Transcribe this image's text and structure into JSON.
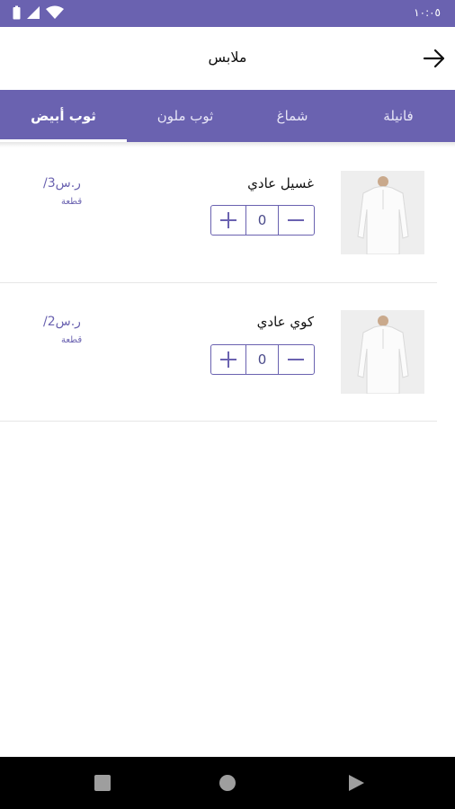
{
  "status_bar": {
    "time": "١٠:٠٥"
  },
  "header": {
    "title": "ملابس"
  },
  "tabs": [
    {
      "label": "فانيلة"
    },
    {
      "label": "شماغ"
    },
    {
      "label": "ثوب ملون"
    },
    {
      "label": "ثوب أبيض"
    }
  ],
  "active_tab": "ثوب أبيض",
  "items": [
    {
      "name": "غسيل عادي",
      "quantity": "0",
      "price": "/3ر.س",
      "unit": "قطعة"
    },
    {
      "name": "كوي عادي",
      "quantity": "0",
      "price": "/2ر.س",
      "unit": "قطعة"
    }
  ],
  "colors": {
    "primary": "#6a62b0",
    "background": "#ffffff",
    "nav_bar": "#000000"
  }
}
